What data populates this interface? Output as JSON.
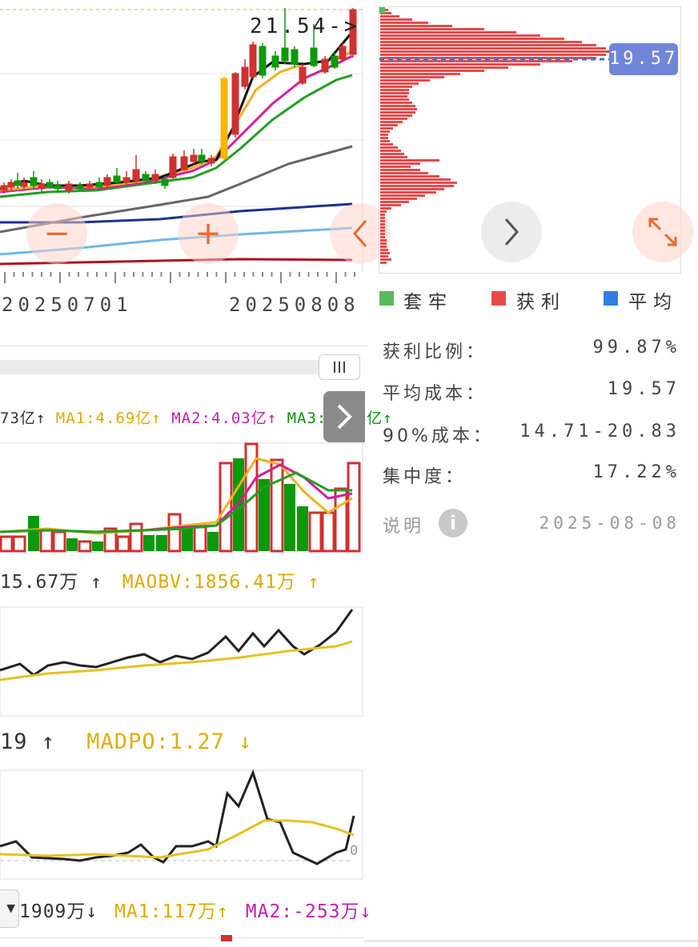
{
  "kline": {
    "high_marker": "21.54->",
    "dates": [
      "20250701",
      "20250808"
    ]
  },
  "zoom_controls": {
    "zoom_out": "−",
    "zoom_in": "+",
    "prev": "‹",
    "next": "›"
  },
  "chip": {
    "avg_label": "19.57",
    "legend": [
      {
        "label": "套牢",
        "color": "#5cb85c"
      },
      {
        "label": "获利",
        "color": "#e84a4a"
      },
      {
        "label": "平均",
        "color": "#2f7fe0"
      }
    ],
    "stats": [
      {
        "label": "获利比例：",
        "value": "99.87%"
      },
      {
        "label": "平均成本：",
        "value": "19.57"
      },
      {
        "label": "90%成本：",
        "value": "14.71-20.83"
      },
      {
        "label": "集中度：",
        "value": "17.22%"
      }
    ],
    "note_label": "说明",
    "date": "2025-08-08"
  },
  "volume": {
    "legend_prefix": "73亿↑",
    "ma1": "MA1:4.69亿↑",
    "ma2": "MA2:4.03亿↑",
    "ma3": "MA3:4.54亿↑"
  },
  "obv": {
    "value": "15.67万 ↑",
    "ma": "MAOBV:1856.41万 ↑"
  },
  "dpo": {
    "value": "19 ↑",
    "ma": "MADPO:1.27 ↓",
    "zero": "0"
  },
  "bottom": {
    "value": "1909万↓",
    "ma1": "MA1:117万↑",
    "ma2": "MA2:-253万↓"
  },
  "colors": {
    "up": "#d03030",
    "down": "#0a9a0a",
    "ma_yellow": "#f0b020",
    "ma_pink": "#d020a0",
    "ma_green": "#20a020",
    "ma_gray": "#666666",
    "ma_navy": "#1f2f8f",
    "ma_lightblue": "#70b8e8",
    "ma_darkred": "#b01020"
  }
}
